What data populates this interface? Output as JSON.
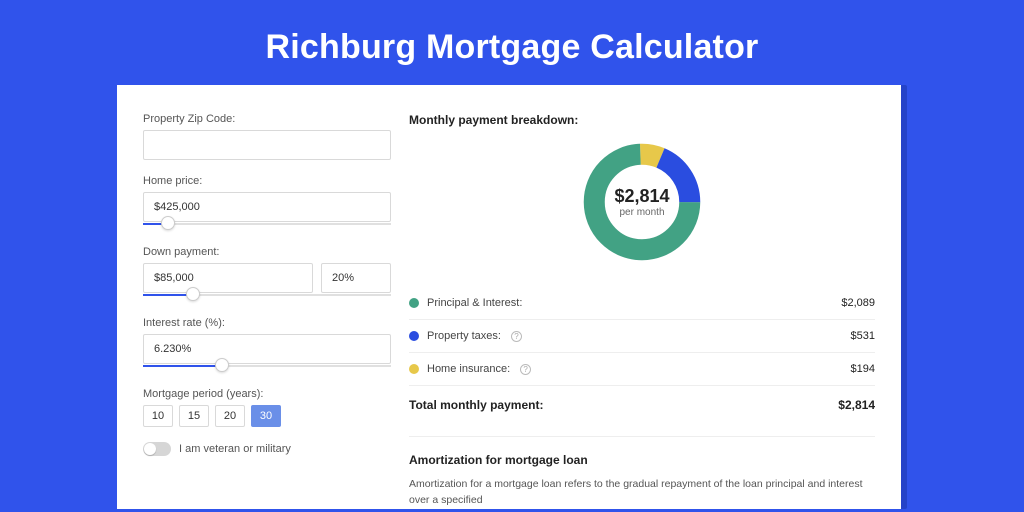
{
  "page": {
    "title": "Richburg Mortgage Calculator"
  },
  "form": {
    "zip_label": "Property Zip Code:",
    "zip_value": "",
    "home_price_label": "Home price:",
    "home_price_value": "$425,000",
    "home_price_slider_pct": 10,
    "down_payment_label": "Down payment:",
    "down_payment_value": "$85,000",
    "down_payment_pct_value": "20%",
    "down_payment_slider_pct": 20,
    "interest_label": "Interest rate (%):",
    "interest_value": "6.230%",
    "interest_slider_pct": 32,
    "period_label": "Mortgage period (years):",
    "periods": [
      {
        "label": "10",
        "active": false
      },
      {
        "label": "15",
        "active": false
      },
      {
        "label": "20",
        "active": false
      },
      {
        "label": "30",
        "active": true
      }
    ],
    "veteran_label": "I am veteran or military"
  },
  "breakdown": {
    "header": "Monthly payment breakdown:",
    "total_amount": "$2,814",
    "total_sub": "per month",
    "rows": [
      {
        "name": "Principal & Interest:",
        "value": "$2,089",
        "color": "green",
        "info": false
      },
      {
        "name": "Property taxes:",
        "value": "$531",
        "color": "blue",
        "info": true
      },
      {
        "name": "Home insurance:",
        "value": "$194",
        "color": "yellow",
        "info": true
      }
    ],
    "total_label": "Total monthly payment:"
  },
  "amortization": {
    "header": "Amortization for mortgage loan",
    "body": "Amortization for a mortgage loan refers to the gradual repayment of the loan principal and interest over a specified"
  },
  "chart_data": {
    "type": "pie",
    "title": "Monthly payment breakdown",
    "series": [
      {
        "name": "Principal & Interest",
        "value": 2089,
        "color": "#42a284"
      },
      {
        "name": "Property taxes",
        "value": 531,
        "color": "#2a4de0"
      },
      {
        "name": "Home insurance",
        "value": 194,
        "color": "#e7c84a"
      }
    ],
    "total": 2814,
    "unit": "USD/month"
  }
}
